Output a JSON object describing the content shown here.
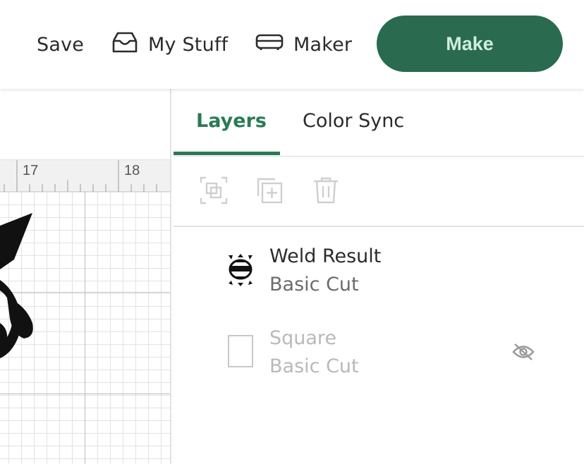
{
  "header": {
    "save_label": "Save",
    "my_stuff_label": "My Stuff",
    "maker_label": "Maker",
    "make_label": "Make"
  },
  "canvas": {
    "ruler_labels": [
      "17",
      "18"
    ]
  },
  "panel": {
    "tabs": [
      {
        "label": "Layers",
        "active": true
      },
      {
        "label": "Color Sync",
        "active": false
      }
    ],
    "layers": [
      {
        "name": "Weld Result",
        "type": "Basic Cut",
        "visible": true,
        "icon": "weld-result-thumbnail"
      },
      {
        "name": "Square",
        "type": "Basic Cut",
        "visible": false,
        "icon": "square-thumbnail"
      }
    ]
  },
  "colors": {
    "accent": "#2a6a4e",
    "accent_text": "#cfeedd",
    "tab_active": "#2a7a55"
  }
}
